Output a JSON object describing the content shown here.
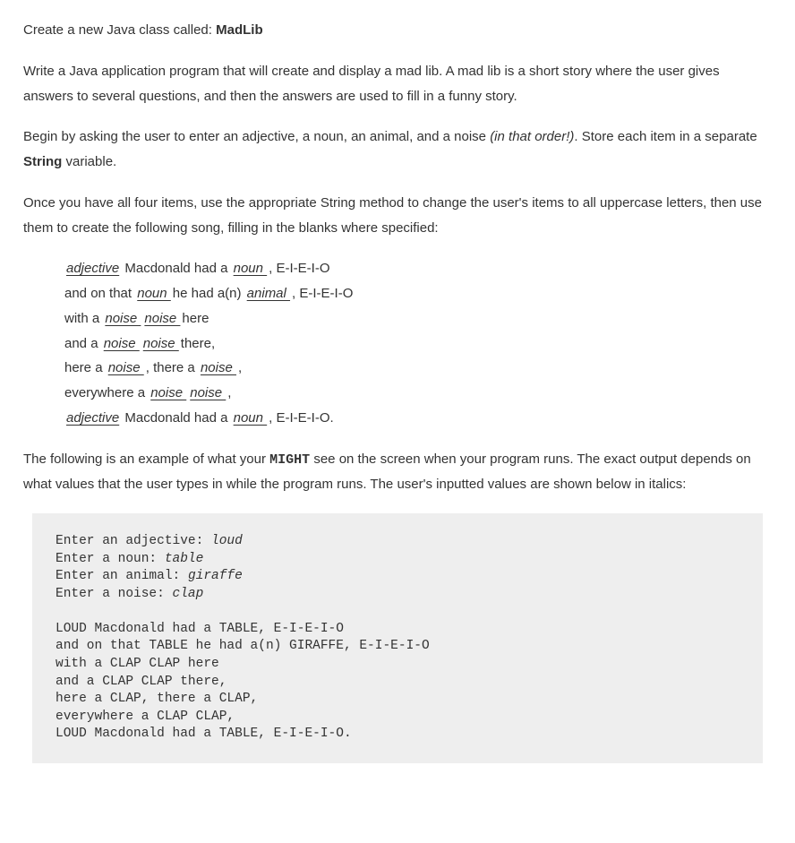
{
  "intro": {
    "line1_pre": "Create a new Java class called: ",
    "line1_bold": "MadLib",
    "p2": "Write a Java application program that will create and display a mad lib. A mad lib is a short story where the user gives answers to several questions, and then the answers are used to fill in a funny story.",
    "p3_a": "Begin by asking the user to enter an adjective, a noun, an animal, and a noise ",
    "p3_italic": "(in that order!)",
    "p3_b": ". Store each item in a separate ",
    "p3_bold": "String",
    "p3_c": " variable.",
    "p4": "Once you have all four items, use the appropriate String method to change the user's items to all uppercase letters, then use them to create the following song, filling in the blanks where specified:"
  },
  "song": {
    "s1_a": "  ",
    "s1_blank1": "adjective",
    "s1_b": "  Macdonald had a ",
    "s1_blank2": " noun ",
    "s1_c": " , E-I-E-I-O",
    "s2_a": "and on that ",
    "s2_blank1": " noun ",
    "s2_b": " he had a(n) ",
    "s2_blank2": " animal ",
    "s2_c": ", E-I-E-I-O",
    "s3_a": "with a ",
    "s3_blank1": " noise ",
    "s3_b": "  ",
    "s3_blank2": " noise ",
    "s3_c": " here",
    "s4_a": "and a ",
    "s4_blank1": " noise ",
    "s4_b": "  ",
    "s4_blank2": " noise ",
    "s4_c": " there,",
    "s5_a": "here a ",
    "s5_blank1": " noise ",
    "s5_b": ", there a ",
    "s5_blank2": " noise ",
    "s5_c": ",",
    "s6_a": "everywhere a ",
    "s6_blank1": " noise ",
    "s6_b": "  ",
    "s6_blank2": " noise ",
    "s6_c": ",",
    "s7_a": "  ",
    "s7_blank1": "adjective",
    "s7_b": "  Macdonald had a ",
    "s7_blank2": " noun ",
    "s7_c": " , E-I-E-I-O."
  },
  "explain": {
    "a": "The following is an example of what your ",
    "b_mono": "MIGHT",
    "c": " see on the screen when your program runs. The exact output depends on what values that the user types in while the program runs. The user's inputted values are shown below in italics:"
  },
  "code": {
    "l1a": "Enter an adjective: ",
    "l1b": "loud",
    "l2a": "Enter a noun: ",
    "l2b": "table",
    "l3a": "Enter an animal: ",
    "l3b": "giraffe",
    "l4a": "Enter a noise: ",
    "l4b": "clap",
    "l5": "",
    "l6": "LOUD Macdonald had a TABLE, E-I-E-I-O",
    "l7": "and on that TABLE he had a(n) GIRAFFE, E-I-E-I-O",
    "l8": "with a CLAP CLAP here",
    "l9": "and a CLAP CLAP there,",
    "l10": "here a CLAP, there a CLAP,",
    "l11": "everywhere a CLAP CLAP,",
    "l12": "LOUD Macdonald had a TABLE, E-I-E-I-O."
  }
}
